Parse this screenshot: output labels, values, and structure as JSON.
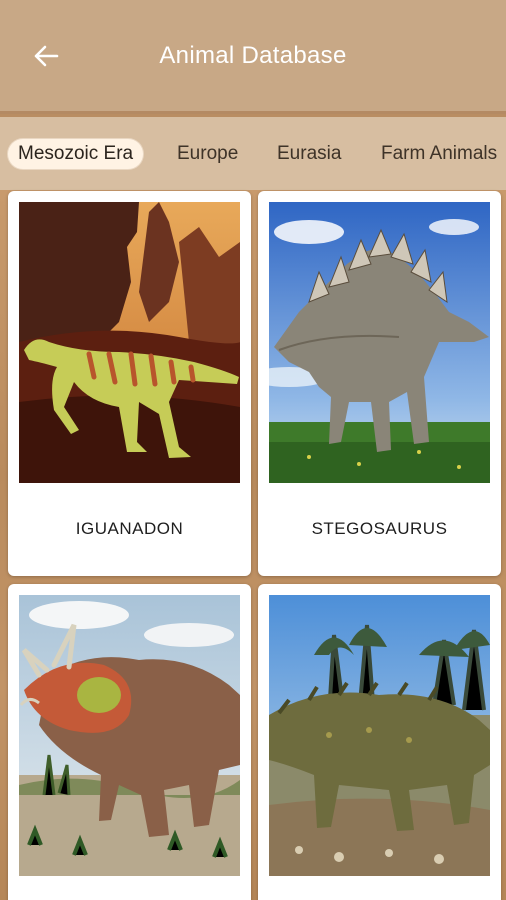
{
  "header": {
    "title": "Animal Database",
    "back_icon": "arrow-left-icon"
  },
  "tabs": [
    {
      "label": "Mesozoic Era",
      "active": true
    },
    {
      "label": "Europe",
      "active": false
    },
    {
      "label": "Eurasia",
      "active": false
    },
    {
      "label": "Farm Animals",
      "active": false
    }
  ],
  "cards": [
    {
      "name": "IGUANADON"
    },
    {
      "name": "STEGOSAURUS"
    },
    {
      "name": ""
    },
    {
      "name": ""
    }
  ],
  "colors": {
    "app_bar": "#c8a886",
    "tab_bar": "#d7bea1",
    "active_tab": "#fff3e4",
    "background": "#b98d62"
  }
}
